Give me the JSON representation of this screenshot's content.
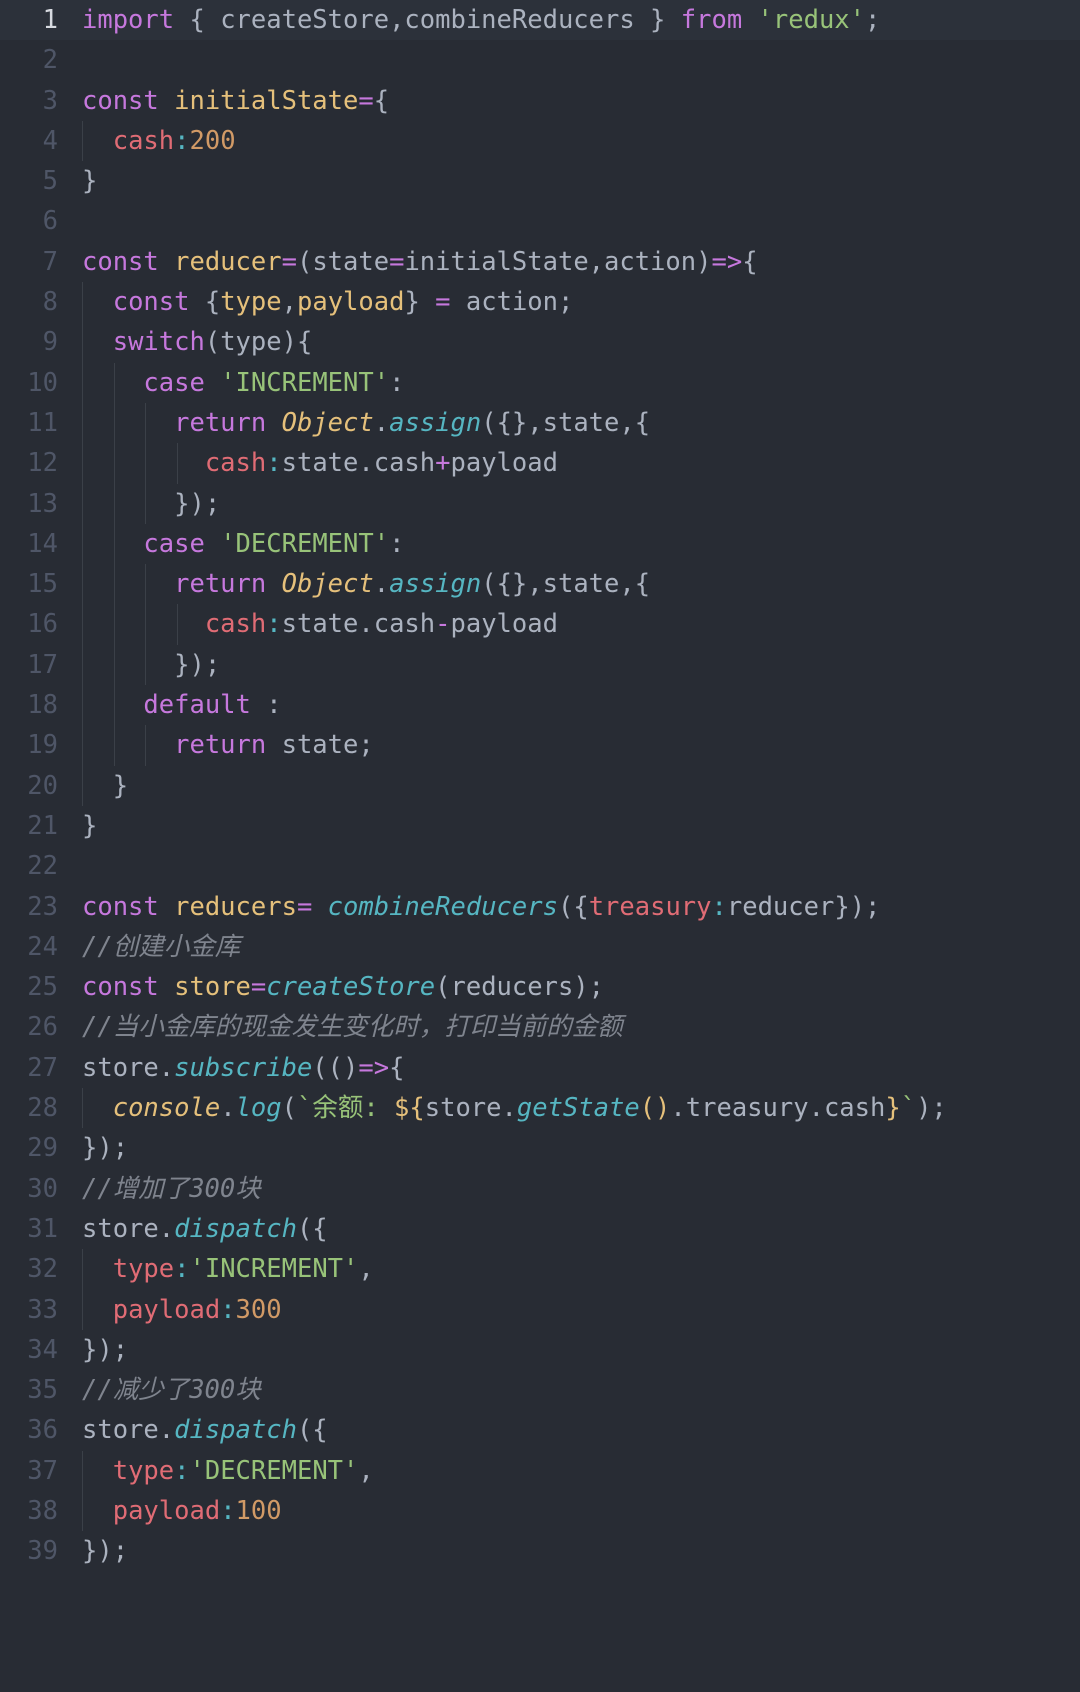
{
  "editor": {
    "theme_name": "one-dark",
    "language": "javascript",
    "background": "#282c34",
    "active_line_background": "#2c313a",
    "gutter_color": "#4f5667",
    "gutter_active_color": "#d7dae0",
    "default_text_color": "#abb2bf",
    "indent_guide_color": "#3b4048",
    "active_line": 1,
    "first_visible_line": 1,
    "last_visible_line": 39,
    "colors": {
      "keyword": "#c678dd",
      "string": "#98c379",
      "variable": "#e5c07b",
      "function": "#56b6c2",
      "property": "#e06c75",
      "number": "#d19a66",
      "operator": "#56b6c2",
      "comment": "#7f848e"
    }
  },
  "lines": [
    {
      "n": "1",
      "text": "import { createStore,combineReducers } from 'redux';"
    },
    {
      "n": "2",
      "text": ""
    },
    {
      "n": "3",
      "text": "const initialState={"
    },
    {
      "n": "4",
      "text": "  cash:200"
    },
    {
      "n": "5",
      "text": "}"
    },
    {
      "n": "6",
      "text": ""
    },
    {
      "n": "7",
      "text": "const reducer=(state=initialState,action)=>{"
    },
    {
      "n": "8",
      "text": "  const {type,payload} = action;"
    },
    {
      "n": "9",
      "text": "  switch(type){"
    },
    {
      "n": "10",
      "text": "    case 'INCREMENT':"
    },
    {
      "n": "11",
      "text": "      return Object.assign({},state,{"
    },
    {
      "n": "12",
      "text": "        cash:state.cash+payload"
    },
    {
      "n": "13",
      "text": "      });"
    },
    {
      "n": "14",
      "text": "    case 'DECREMENT':"
    },
    {
      "n": "15",
      "text": "      return Object.assign({},state,{"
    },
    {
      "n": "16",
      "text": "        cash:state.cash-payload"
    },
    {
      "n": "17",
      "text": "      });"
    },
    {
      "n": "18",
      "text": "    default :"
    },
    {
      "n": "19",
      "text": "      return state;"
    },
    {
      "n": "20",
      "text": "  }"
    },
    {
      "n": "21",
      "text": "}"
    },
    {
      "n": "22",
      "text": ""
    },
    {
      "n": "23",
      "text": "const reducers= combineReducers({treasury:reducer});"
    },
    {
      "n": "24",
      "text": "//创建小金库"
    },
    {
      "n": "25",
      "text": "const store=createStore(reducers);"
    },
    {
      "n": "26",
      "text": "//当小金库的现金发生变化时，打印当前的金额"
    },
    {
      "n": "27",
      "text": "store.subscribe(()=>{"
    },
    {
      "n": "28",
      "text": "  console.log(`余额: ${store.getState().treasury.cash}`);"
    },
    {
      "n": "29",
      "text": "});"
    },
    {
      "n": "30",
      "text": "//增加了300块"
    },
    {
      "n": "31",
      "text": "store.dispatch({"
    },
    {
      "n": "32",
      "text": "  type:'INCREMENT',"
    },
    {
      "n": "33",
      "text": "  payload:300"
    },
    {
      "n": "34",
      "text": "});"
    },
    {
      "n": "35",
      "text": "//减少了300块"
    },
    {
      "n": "36",
      "text": "store.dispatch({"
    },
    {
      "n": "37",
      "text": "  type:'DECREMENT',"
    },
    {
      "n": "38",
      "text": "  payload:100"
    },
    {
      "n": "39",
      "text": "});"
    }
  ]
}
